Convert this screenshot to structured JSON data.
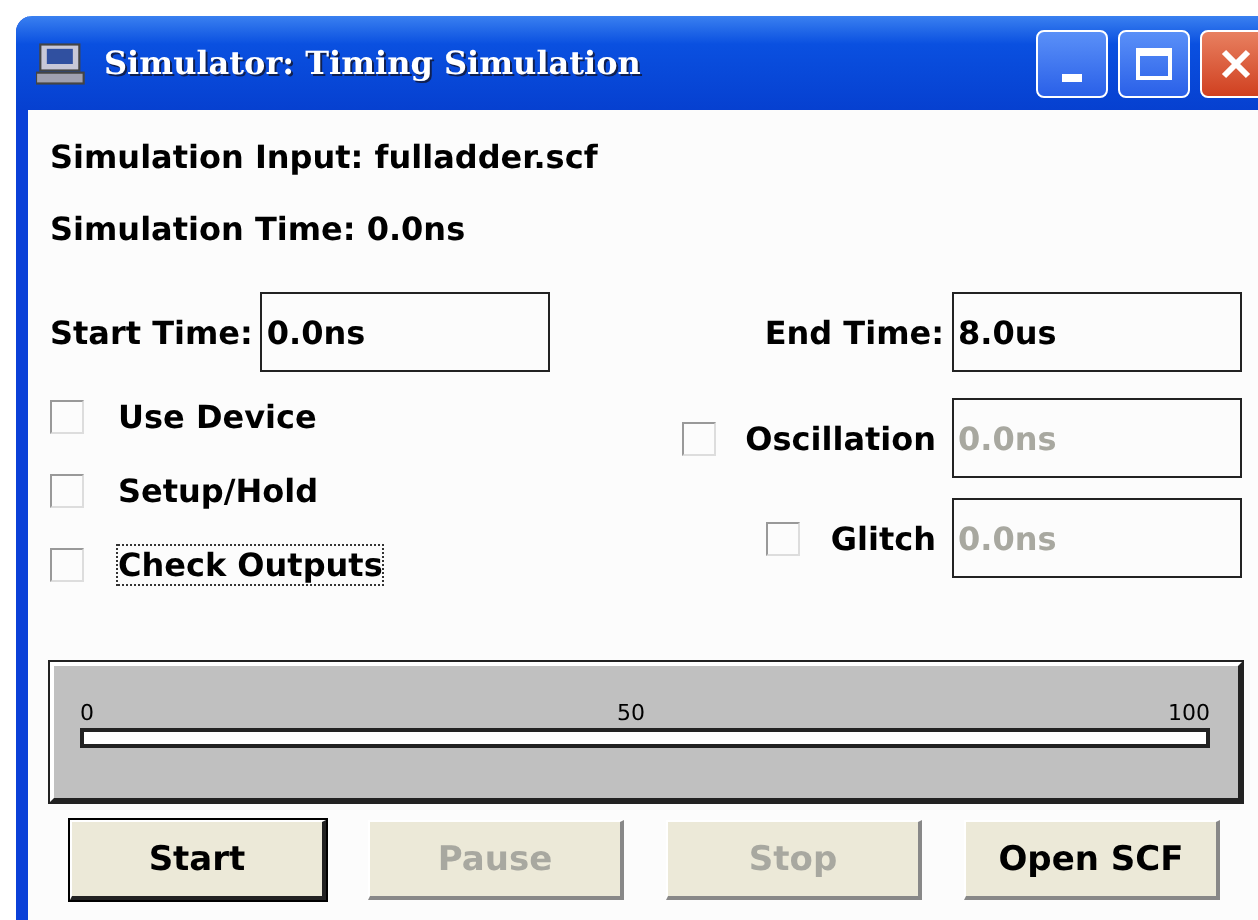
{
  "window": {
    "title": "Simulator: Timing Simulation"
  },
  "info": [
    "Simulation Input: fulladder.scf",
    "Simulation Time: 0.0ns"
  ],
  "start_time": {
    "label": "Start Time:",
    "value": "0.0ns"
  },
  "end_time": {
    "label": "End Time:",
    "value": "8.0us"
  },
  "left_options": [
    {
      "label": "Use Device",
      "checked": false,
      "focused": false
    },
    {
      "label": "Setup/Hold",
      "checked": false,
      "focused": false
    },
    {
      "label": "Check Outputs",
      "checked": false,
      "focused": true
    }
  ],
  "right_options": [
    {
      "label": "Oscillation",
      "checked": false,
      "value": "0.0ns",
      "disabled": true
    },
    {
      "label": "Glitch",
      "checked": false,
      "value": "0.0ns",
      "disabled": true
    }
  ],
  "progress": {
    "ticks": [
      "0",
      "50",
      "100"
    ],
    "level": 0
  },
  "buttons": [
    {
      "label": "Start",
      "disabled": false,
      "default": true
    },
    {
      "label": "Pause",
      "disabled": true,
      "default": false
    },
    {
      "label": "Stop",
      "disabled": true,
      "default": false
    },
    {
      "label": "Open SCF",
      "disabled": false,
      "default": false
    }
  ]
}
